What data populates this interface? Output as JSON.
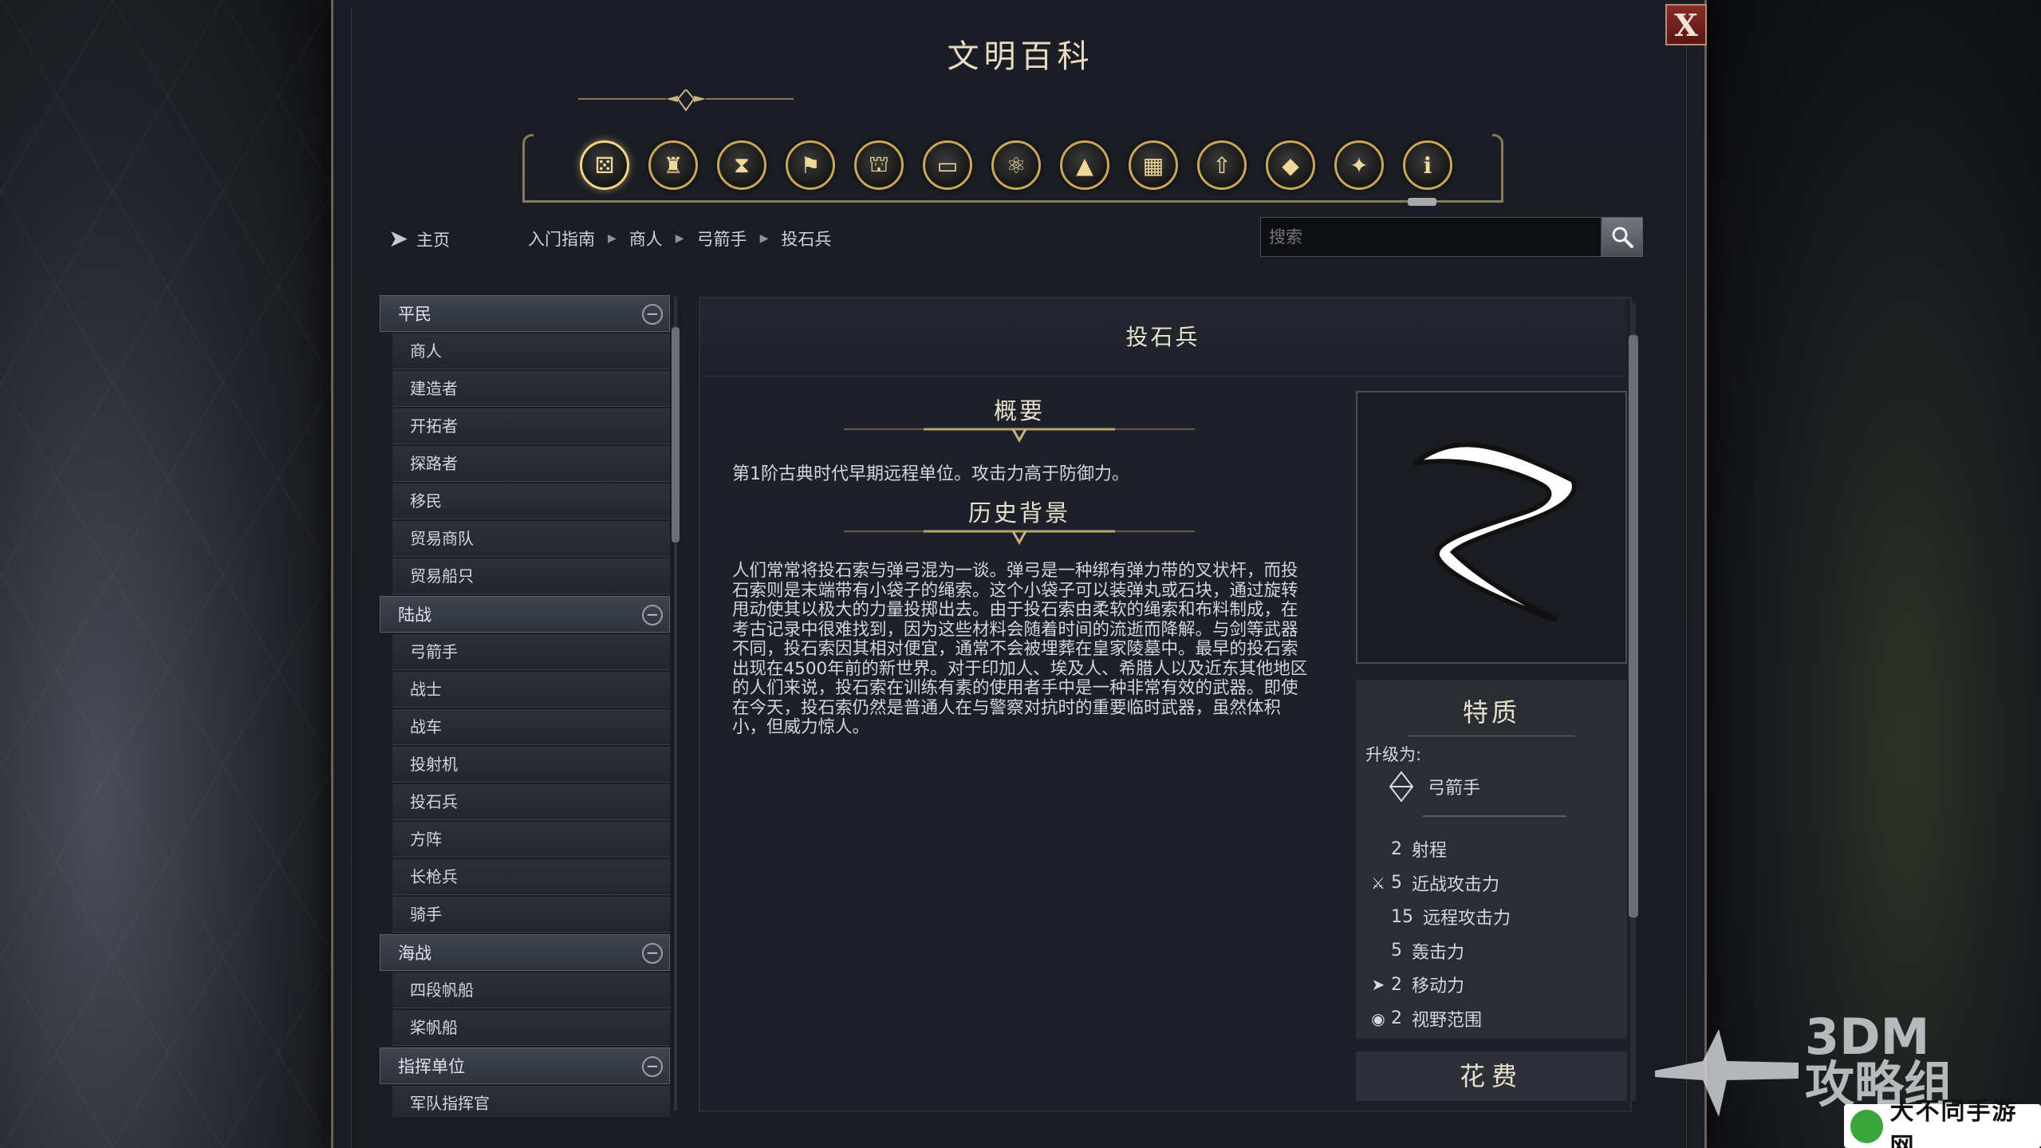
{
  "window": {
    "title": "文明百科",
    "close_label": "X"
  },
  "categories": [
    {
      "icon": "units-icon",
      "glyph": "⚄",
      "active": true
    },
    {
      "icon": "goblet-icon",
      "glyph": "♜"
    },
    {
      "icon": "hourglass-icon",
      "glyph": "⧗"
    },
    {
      "icon": "flag-icon",
      "glyph": "⚑"
    },
    {
      "icon": "government-icon",
      "glyph": "⛫"
    },
    {
      "icon": "book-icon",
      "glyph": "▭"
    },
    {
      "icon": "atom-icon",
      "glyph": "⚛"
    },
    {
      "icon": "mountain-icon",
      "glyph": "▲"
    },
    {
      "icon": "city-icon",
      "glyph": "▦"
    },
    {
      "icon": "upgrade-arrow-icon",
      "glyph": "⇧"
    },
    {
      "icon": "resource-icon",
      "glyph": "◆"
    },
    {
      "icon": "dove-icon",
      "glyph": "✦"
    },
    {
      "icon": "info-icon",
      "glyph": "ℹ"
    }
  ],
  "nav": {
    "home_label": "主页",
    "breadcrumb": [
      "入门指南",
      "商人",
      "弓箭手",
      "投石兵"
    ]
  },
  "search": {
    "placeholder": "搜索",
    "value": ""
  },
  "sidebar": {
    "groups": [
      {
        "label": "平民",
        "toggle": "−",
        "items": [
          "商人",
          "建造者",
          "开拓者",
          "探路者",
          "移民",
          "贸易商队",
          "贸易船只"
        ]
      },
      {
        "label": "陆战",
        "toggle": "−",
        "items": [
          "弓箭手",
          "战士",
          "战车",
          "投射机",
          "投石兵",
          "方阵",
          "长枪兵",
          "骑手"
        ]
      },
      {
        "label": "海战",
        "toggle": "−",
        "items": [
          "四段帆船",
          "桨帆船"
        ]
      },
      {
        "label": "指挥单位",
        "toggle": "−",
        "items": [
          "军队指挥官"
        ]
      }
    ]
  },
  "article": {
    "title": "投石兵",
    "summary_heading": "概要",
    "summary": "第1阶古典时代早期远程单位。攻击力高于防御力。",
    "history_heading": "历史背景",
    "history": "人们常常将投石索与弹弓混为一谈。弹弓是一种绑有弹力带的叉状杆，而投石索则是末端带有小袋子的绳索。这个小袋子可以装弹丸或石块，通过旋转甩动使其以极大的力量投掷出去。由于投石索由柔软的绳索和布料制成，在考古记录中很难找到，因为这些材料会随着时间的流逝而降解。与剑等武器不同，投石索因其相对便宜，通常不会被埋葬在皇家陵墓中。最早的投石索出现在4500年前的新世界。对于印加人、埃及人、希腊人以及近东其他地区的人们来说，投石索在训练有素的使用者手中是一种非常有效的武器。即使在今天，投石索仍然是普通人在与警察对抗时的重要临时武器，虽然体积小，但威力惊人。"
  },
  "traits": {
    "title": "特质",
    "upgrade_label": "升级为:",
    "upgrade_to": "弓箭手",
    "stats": [
      {
        "icon": "",
        "num": "2",
        "label": "射程"
      },
      {
        "icon": "melee-sword-icon",
        "glyph": "⚔",
        "num": "5",
        "label": "近战攻击力"
      },
      {
        "icon": "",
        "num": "15",
        "label": "远程攻击力"
      },
      {
        "icon": "",
        "num": "5",
        "label": "轰击力"
      },
      {
        "icon": "movement-arrow-icon",
        "glyph": "➤",
        "num": "2",
        "label": "移动力"
      },
      {
        "icon": "sight-eye-icon",
        "glyph": "◉",
        "num": "2",
        "label": "视野范围"
      }
    ]
  },
  "cost": {
    "title": "花费"
  },
  "watermark": {
    "text1": "3DM",
    "text2": "攻略组",
    "badge": "大不同手游网"
  }
}
